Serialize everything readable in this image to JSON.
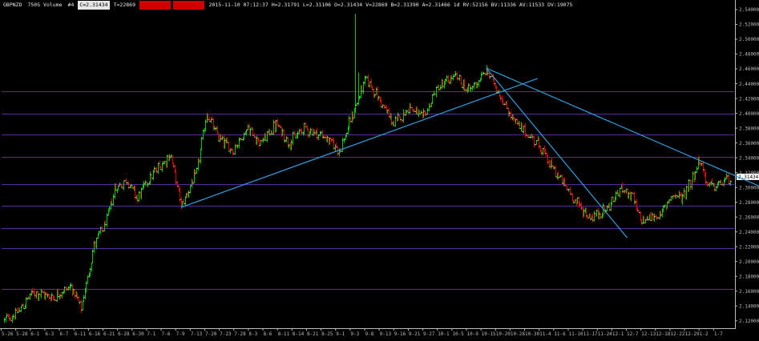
{
  "header": {
    "symbol": "GBPNZD",
    "period": "750S Volume",
    "hash": "#4",
    "close_tag": "C=2.31434",
    "ticks": "T=22869",
    "red_tag_1": "A=2.00000",
    "red_tag_2": "B=2.00000",
    "bar_info": "2015-11-10 07:12:37 H=2.31791 L=2.31106 O=2.31434 V=22869 B=2.31390 A=2.31466 1d RV:52156 BV:11336 AV:11533 DV:19075"
  },
  "colors": {
    "background": "#000000",
    "up_bar": "#00cc00",
    "down_bar": "#e00000",
    "level_line": "#5a2a9a",
    "trend_line": "#2f9fe0",
    "axis": "#bbbbbb",
    "price_tag_bg": "#ffffff",
    "price_tag_fg": "#000000"
  },
  "chart_data": {
    "type": "ohlc",
    "instrument": "GBPNZD",
    "ylim": [
      2.11,
      2.54
    ],
    "y_ticks": [
      "2.54000",
      "2.52000",
      "2.50000",
      "2.48000",
      "2.46000",
      "2.44000",
      "2.42000",
      "2.40000",
      "2.38000",
      "2.36000",
      "2.34000",
      "2.32000",
      "2.30000",
      "2.28000",
      "2.26000",
      "2.24000",
      "2.22000",
      "2.20000",
      "2.18000",
      "2.16000",
      "2.14000",
      "2.12000"
    ],
    "y_tick_values": [
      2.54,
      2.52,
      2.5,
      2.48,
      2.46,
      2.44,
      2.42,
      2.4,
      2.38,
      2.36,
      2.34,
      2.32,
      2.3,
      2.28,
      2.26,
      2.24,
      2.22,
      2.2,
      2.18,
      2.16,
      2.14,
      2.12
    ],
    "current_price_label": "2.31434",
    "current_price": 2.31434,
    "x_tick_labels": [
      "5-26",
      "5-28",
      "6-1",
      "6-3",
      "6-7",
      "6-11",
      "6-16",
      "6-21",
      "6-28",
      "6-30",
      "7-1",
      "7-6",
      "7-9",
      "7-13",
      "7-20",
      "7-23",
      "7-28",
      "8-3",
      "8-6",
      "8-11",
      "8-14",
      "8-21",
      "8-25",
      "9-1",
      "9-3",
      "9-8",
      "9-13",
      "9-16",
      "9-21",
      "9-27",
      "10-1",
      "10-5",
      "10-9",
      "10-15",
      "10-20",
      "10-28",
      "10-30",
      "11-4",
      "11-6",
      "11-10",
      "11-17",
      "11-24",
      "12-1",
      "12-7",
      "12-13",
      "12-18",
      "12-22",
      "12-29",
      "1-2",
      "1-7"
    ],
    "horizontal_levels": [
      2.43,
      2.4,
      2.371,
      2.341,
      2.305,
      2.275,
      2.245,
      2.218,
      2.163
    ],
    "trend_lines": [
      {
        "from": {
          "bar": 138,
          "price": 2.273
        },
        "to": {
          "bar": 416,
          "price": 2.447
        }
      },
      {
        "from": {
          "bar": 376,
          "price": 2.461
        },
        "to": {
          "bar": 486,
          "price": 2.232
        }
      },
      {
        "from": {
          "bar": 376,
          "price": 2.461
        },
        "to": {
          "bar": 614,
          "price": 2.283
        }
      }
    ],
    "anchors": [
      [
        0,
        2.121
      ],
      [
        10,
        2.13
      ],
      [
        22,
        2.158
      ],
      [
        38,
        2.152
      ],
      [
        52,
        2.167
      ],
      [
        60,
        2.135
      ],
      [
        70,
        2.222
      ],
      [
        80,
        2.255
      ],
      [
        86,
        2.298
      ],
      [
        96,
        2.31
      ],
      [
        104,
        2.285
      ],
      [
        112,
        2.31
      ],
      [
        124,
        2.335
      ],
      [
        130,
        2.343
      ],
      [
        138,
        2.275
      ],
      [
        150,
        2.32
      ],
      [
        158,
        2.4
      ],
      [
        166,
        2.37
      ],
      [
        178,
        2.35
      ],
      [
        190,
        2.38
      ],
      [
        200,
        2.36
      ],
      [
        212,
        2.385
      ],
      [
        222,
        2.36
      ],
      [
        234,
        2.38
      ],
      [
        248,
        2.37
      ],
      [
        262,
        2.35
      ],
      [
        276,
        2.42
      ],
      [
        282,
        2.448
      ],
      [
        292,
        2.42
      ],
      [
        304,
        2.385
      ],
      [
        316,
        2.41
      ],
      [
        326,
        2.392
      ],
      [
        338,
        2.435
      ],
      [
        352,
        2.45
      ],
      [
        362,
        2.43
      ],
      [
        376,
        2.457
      ],
      [
        384,
        2.435
      ],
      [
        392,
        2.405
      ],
      [
        402,
        2.38
      ],
      [
        416,
        2.36
      ],
      [
        426,
        2.33
      ],
      [
        436,
        2.305
      ],
      [
        446,
        2.28
      ],
      [
        456,
        2.26
      ],
      [
        462,
        2.262
      ],
      [
        470,
        2.272
      ],
      [
        482,
        2.3
      ],
      [
        490,
        2.285
      ],
      [
        496,
        2.255
      ],
      [
        504,
        2.26
      ],
      [
        512,
        2.262
      ],
      [
        520,
        2.29
      ],
      [
        528,
        2.285
      ],
      [
        536,
        2.31
      ],
      [
        542,
        2.338
      ],
      [
        548,
        2.305
      ],
      [
        554,
        2.3
      ],
      [
        562,
        2.31
      ],
      [
        566,
        2.314
      ]
    ],
    "spikes": [
      {
        "bar": 274,
        "high": 2.534
      },
      {
        "bar": 276,
        "high": 2.455
      },
      {
        "bar": 282,
        "high": 2.45
      }
    ],
    "bar_count": 567
  }
}
